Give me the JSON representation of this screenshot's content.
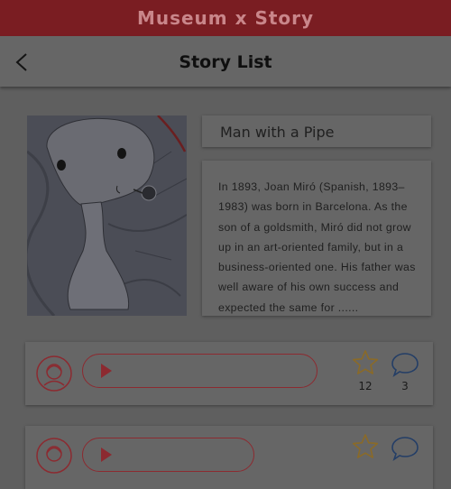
{
  "app": {
    "title": "Museum x Story"
  },
  "header": {
    "title": "Story List",
    "back_icon": "back-arrow-icon"
  },
  "story": {
    "title": "Man with a Pipe",
    "description": "In 1893, Joan Miró (Spanish, 1893–1983) was born in Barcelona. As the son of a goldsmith, Miró did not grow up in an art-oriented family, but in a business-oriented one. His father was well aware of his own success and expected the same for ......"
  },
  "comments": [
    {
      "likes": "12",
      "comment_count": "3",
      "avatar_icon": "user-avatar-icon",
      "play_icon": "play-icon"
    },
    {
      "likes": "",
      "comment_count": "",
      "avatar_icon": "user-avatar-icon",
      "play_icon": "play-icon"
    }
  ],
  "colors": {
    "app_bar": "#7a1d22",
    "accent_red": "#8c2a30",
    "star": "#8a6a28",
    "comment_icon": "#243e66",
    "overlay_background": "#5f5f5f"
  }
}
